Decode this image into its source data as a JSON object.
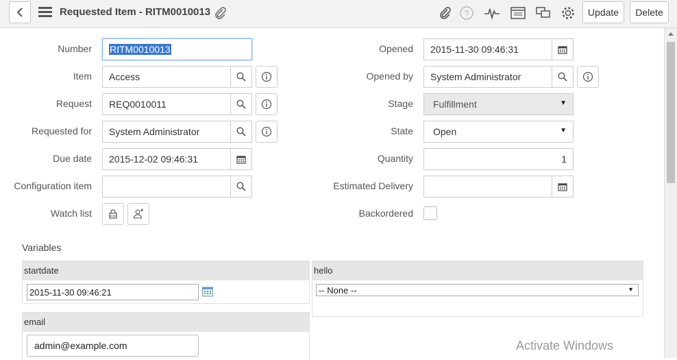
{
  "header": {
    "title": "Requested Item - RITM0010013",
    "update_label": "Update",
    "delete_label": "Delete"
  },
  "form": {
    "left": {
      "number_label": "Number",
      "number_value": "RITM0010013",
      "item_label": "Item",
      "item_value": "Access",
      "request_label": "Request",
      "request_value": "REQ0010011",
      "requested_for_label": "Requested for",
      "requested_for_value": "System Administrator",
      "due_date_label": "Due date",
      "due_date_value": "2015-12-02 09:46:31",
      "config_item_label": "Configuration item",
      "config_item_value": "",
      "watch_list_label": "Watch list"
    },
    "right": {
      "opened_label": "Opened",
      "opened_value": "2015-11-30 09:46:31",
      "opened_by_label": "Opened by",
      "opened_by_value": "System Administrator",
      "stage_label": "Stage",
      "stage_value": "Fulfillment",
      "state_label": "State",
      "state_value": "Open",
      "quantity_label": "Quantity",
      "quantity_value": "1",
      "estimated_delivery_label": "Estimated Delivery",
      "estimated_delivery_value": "",
      "backordered_label": "Backordered"
    }
  },
  "variables": {
    "section_label": "Variables",
    "startdate_label": "startdate",
    "startdate_value": "2015-11-30 09:46:21",
    "hello_label": "hello",
    "hello_value": "-- None --",
    "email_label": "email",
    "email_value": "admin@example.com"
  },
  "overlay": {
    "watermark": "Activate Windows"
  },
  "colors": {
    "header_bg": "#f2f2f2",
    "focus_border": "#7fb2e6",
    "selection": "#3a78c9"
  }
}
